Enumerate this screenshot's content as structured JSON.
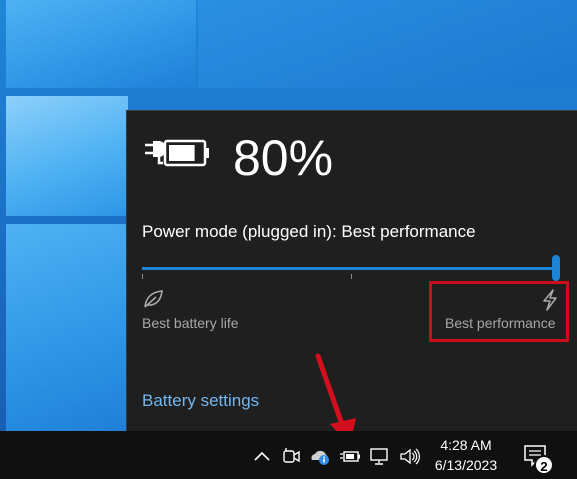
{
  "battery": {
    "percent_text": "80%",
    "level": 0.8,
    "state_icon": "battery-charging-icon"
  },
  "power_mode": {
    "label": "Power mode (plugged in): Best performance",
    "slider_value": 1.0,
    "left_label": "Best battery life",
    "left_icon": "leaf-icon",
    "right_label": "Best performance",
    "right_icon": "lightning-bolt-icon"
  },
  "links": {
    "battery_settings": "Battery settings"
  },
  "taskbar": {
    "time": "4:28 AM",
    "date": "6/13/2023",
    "notification_count": "2",
    "tray_icons": [
      "chevron-up-icon",
      "meet-now-icon",
      "onedrive-icon",
      "battery-icon",
      "network-icon",
      "volume-icon"
    ]
  },
  "colors": {
    "accent": "#1e84d6",
    "flyout_bg": "#1f1f1f",
    "taskbar_bg": "#101010",
    "link": "#73b6ee",
    "annotation": "#cc0d1a"
  }
}
